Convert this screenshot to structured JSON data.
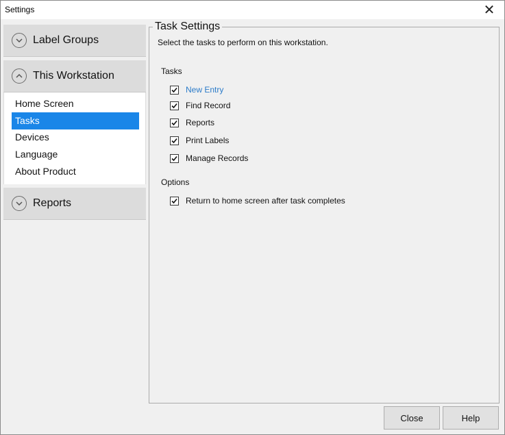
{
  "window": {
    "title": "Settings",
    "close_glyph": "✕"
  },
  "accordion": {
    "groups": [
      {
        "label": "Label Groups",
        "icon": "chevron-down-icon"
      },
      {
        "label": "This Workstation",
        "icon": "chevron-up-icon"
      },
      {
        "label": "Reports",
        "icon": "chevron-down-icon"
      }
    ],
    "workstation_items": [
      {
        "label": "Home Screen"
      },
      {
        "label": "Tasks",
        "selected": true
      },
      {
        "label": "Devices"
      },
      {
        "label": "Language"
      },
      {
        "label": "About Product"
      }
    ]
  },
  "task_settings": {
    "title": "Task Settings",
    "description": "Select the tasks to perform on this workstation.",
    "tasks_label": "Tasks",
    "tasks": [
      {
        "label": "New Entry",
        "checked": true
      },
      {
        "label": "Find Record",
        "checked": true
      },
      {
        "label": "Reports",
        "checked": true
      },
      {
        "label": "Print Labels",
        "checked": true
      },
      {
        "label": "Manage Records",
        "checked": true
      }
    ],
    "options_label": "Options",
    "options": [
      {
        "label": "Return to home screen after task completes",
        "checked": true
      }
    ]
  },
  "buttons": {
    "close": "Close",
    "help": "Help"
  },
  "colors": {
    "selection": "#1a86e8",
    "link_text": "#2b7bc9"
  }
}
